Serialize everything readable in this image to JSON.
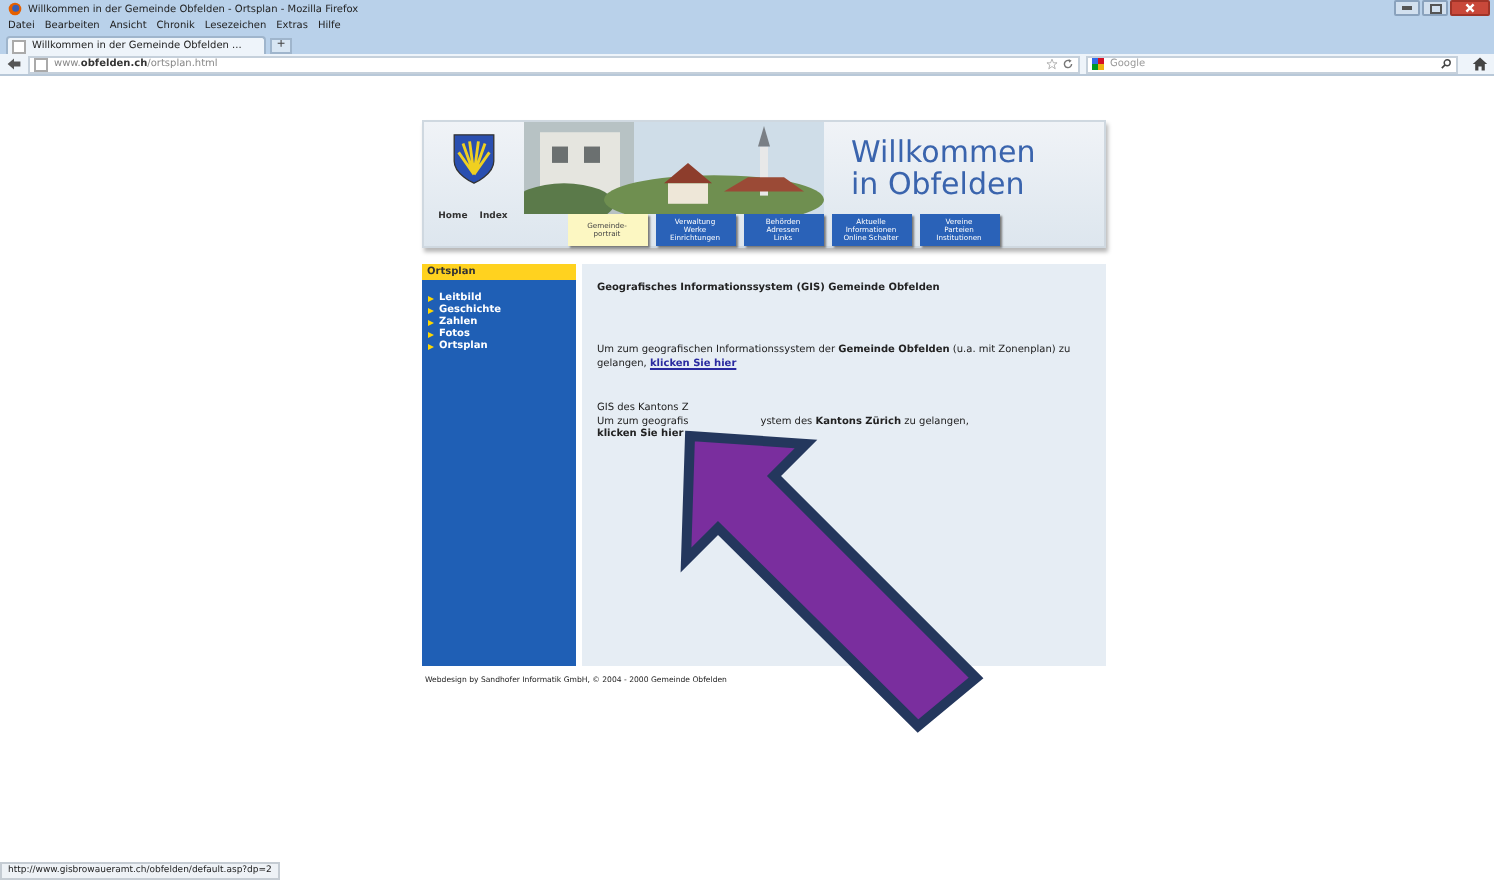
{
  "window": {
    "title": "Willkommen in der Gemeinde Obfelden - Ortsplan - Mozilla Firefox"
  },
  "menu": [
    "Datei",
    "Bearbeiten",
    "Ansicht",
    "Chronik",
    "Lesezeichen",
    "Extras",
    "Hilfe"
  ],
  "tabs": [
    {
      "label": "Willkommen in der Gemeinde Obfelden ...",
      "selected": true
    }
  ],
  "new_tab": "+",
  "address_bar": {
    "prefix": "www.",
    "host": "obfelden.ch",
    "path": "/ortsplan.html"
  },
  "search": {
    "placeholder": "Google"
  },
  "header": {
    "title_lines": [
      "Willkommen",
      "in Obfelden"
    ],
    "links": [
      "Home",
      "Index"
    ],
    "nav": [
      {
        "label": "Gemeinde-\nportrait",
        "selected": true
      },
      {
        "label": "Verwaltung\nWerke\nEinrichtungen",
        "selected": false
      },
      {
        "label": "Behörden\nAdressen\nLinks",
        "selected": false
      },
      {
        "label": "Aktuelle\nInformationen\nOnline Schalter",
        "selected": false
      },
      {
        "label": "Vereine\nParteien\nInstitutionen",
        "selected": false
      }
    ]
  },
  "sidebar": {
    "title": "Ortsplan",
    "items": [
      "Leitbild",
      "Geschichte",
      "Zahlen",
      "Fotos",
      "Ortsplan"
    ]
  },
  "content": {
    "heading": "Geografisches Informationssystem (GIS) Gemeinde Obfelden",
    "paragraph": "Um zum geografischen Informationssystem der **Gemeinde Obfelden** (u.a. mit Zonenplan) zu gelangen,",
    "link": "klicken Sie hier",
    "gis_heading": "GIS des Kantons Z",
    "gis_line_start": "Um zum geografis",
    "gis_line_end": "ystem des **Kantons Zürich** zu gelangen,",
    "gis_link": "klicken Sie hier"
  },
  "footer": "Webdesign by Sandhofer Informatik GmbH, © 2004 - 2000 Gemeinde Obfelden",
  "status_bar": "http://www.gisbrowaueramt.ch/obfelden/default.asp?dp=2"
}
